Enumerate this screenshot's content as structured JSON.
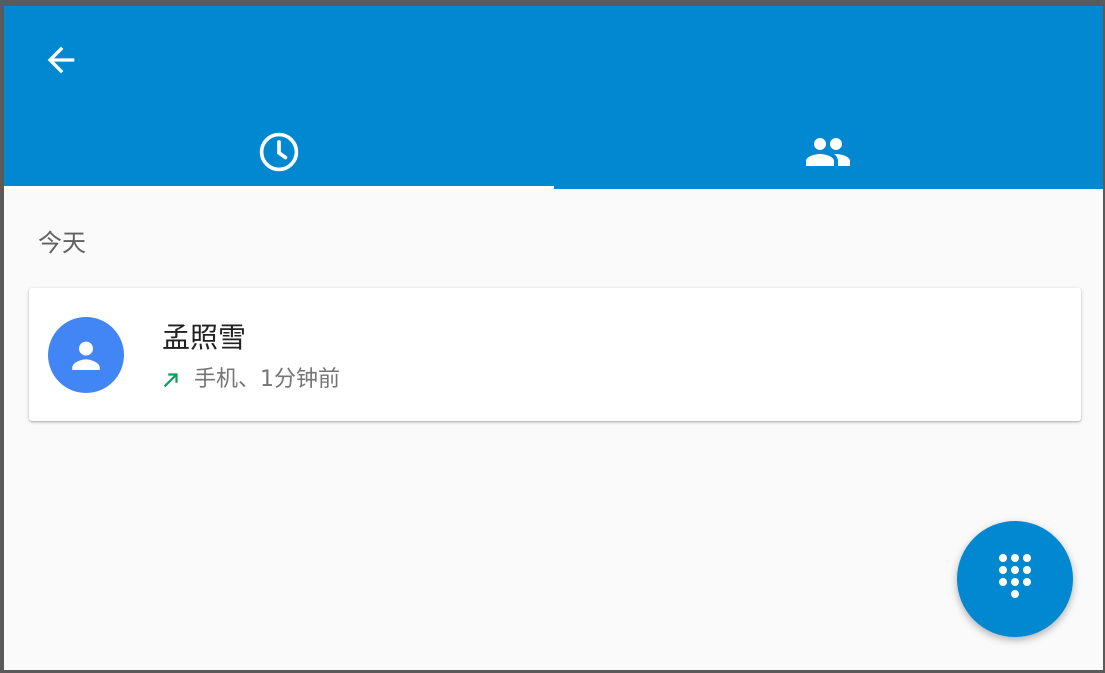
{
  "app": {
    "accent_color": "#0288d1",
    "background_color": "#fafafa"
  },
  "toolbar": {
    "back_icon": "arrow-left-icon"
  },
  "tabs": [
    {
      "icon": "clock-history-icon",
      "active": true
    },
    {
      "icon": "people-contacts-icon",
      "active": false
    }
  ],
  "call_log": {
    "section_header": "今天",
    "entries": [
      {
        "name": "孟照雪",
        "call_type_icon": "outgoing-call-arrow-icon",
        "call_type_color": "#0f9d58",
        "details": "手机、1分钟前",
        "avatar_icon": "person-icon",
        "avatar_color": "#4285f4"
      }
    ]
  },
  "fab": {
    "icon": "dialpad-icon"
  }
}
